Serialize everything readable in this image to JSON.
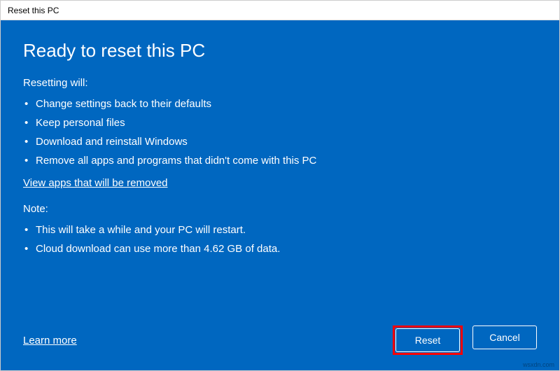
{
  "titlebar": {
    "title": "Reset this PC"
  },
  "main": {
    "heading": "Ready to reset this PC",
    "resetting_label": "Resetting will:",
    "resetting_items": [
      "Change settings back to their defaults",
      "Keep personal files",
      "Download and reinstall Windows",
      "Remove all apps and programs that didn't come with this PC"
    ],
    "view_apps_link": "View apps that will be removed",
    "note_label": "Note:",
    "note_items": [
      "This will take a while and your PC will restart.",
      "Cloud download can use more than 4.62 GB of data."
    ]
  },
  "footer": {
    "learn_more": "Learn more",
    "reset_label": "Reset",
    "cancel_label": "Cancel"
  },
  "watermark": "wsxdn.com"
}
